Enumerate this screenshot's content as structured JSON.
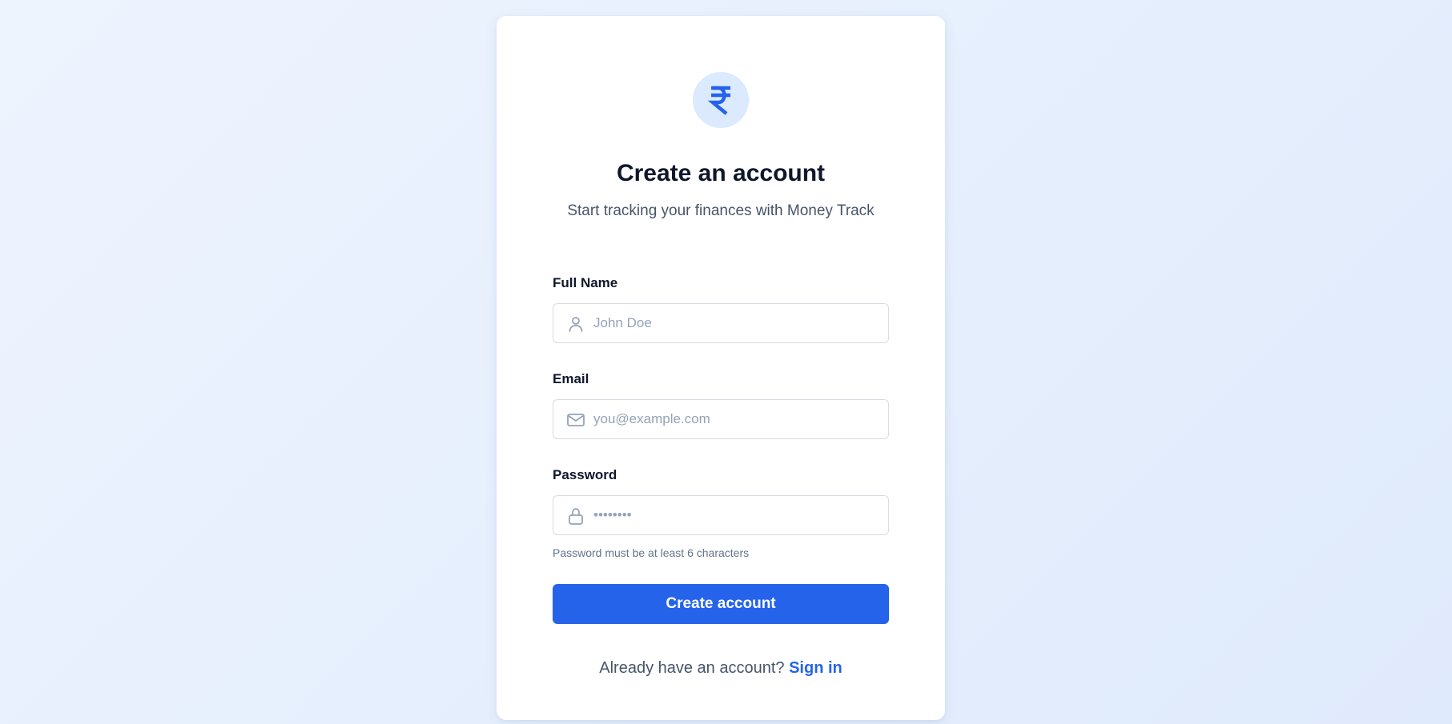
{
  "brand": {
    "icon": "rupee-icon",
    "icon_glyph": "₹",
    "accent_color": "#2563eb",
    "icon_bg_color": "#dbeafe"
  },
  "header": {
    "title": "Create an account",
    "subtitle": "Start tracking your finances with Money Track"
  },
  "form": {
    "full_name": {
      "label": "Full Name",
      "placeholder": "John Doe",
      "value": "",
      "icon": "user-icon"
    },
    "email": {
      "label": "Email",
      "placeholder": "you@example.com",
      "value": "",
      "icon": "mail-icon"
    },
    "password": {
      "label": "Password",
      "placeholder": "••••••••",
      "value": "",
      "icon": "lock-icon",
      "hint": "Password must be at least 6 characters"
    },
    "submit_label": "Create account"
  },
  "footer": {
    "prompt": "Already have an account? ",
    "link_label": "Sign in"
  }
}
